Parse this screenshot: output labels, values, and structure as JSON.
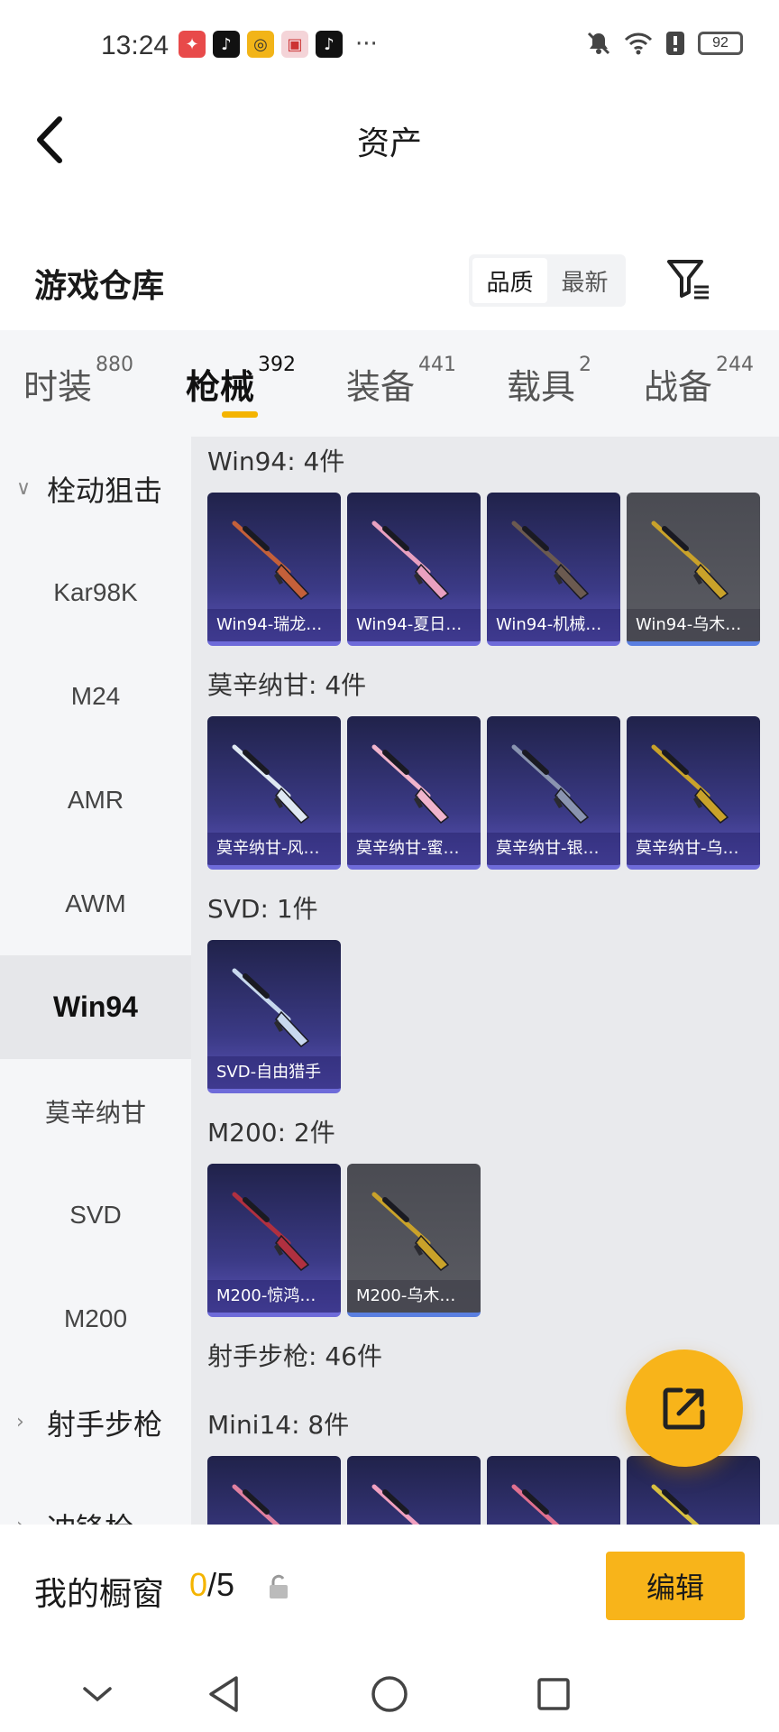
{
  "status_bar": {
    "time": "13:24",
    "notifications": [
      "huawei-app-icon",
      "tiktok-icon",
      "target-app-icon",
      "gift-app-icon",
      "tiktok-icon"
    ],
    "more": "···",
    "battery": "92"
  },
  "header": {
    "title": "资产"
  },
  "warehouse": {
    "title": "游戏仓库",
    "sort_options": [
      "品质",
      "最新"
    ],
    "active_sort": "品质"
  },
  "tabs": [
    {
      "label": "时装",
      "count": "880"
    },
    {
      "label": "枪械",
      "count": "392",
      "active": true
    },
    {
      "label": "装备",
      "count": "441"
    },
    {
      "label": "载具",
      "count": "2"
    },
    {
      "label": "战备",
      "count": "244"
    }
  ],
  "sidebar": {
    "groups": [
      {
        "label": "栓动狙击",
        "expanded": true
      },
      {
        "label": "射手步枪",
        "expanded": false
      },
      {
        "label": "冲锋枪",
        "expanded": false
      }
    ],
    "items": [
      "Kar98K",
      "M24",
      "AMR",
      "AWM",
      "Win94",
      "莫辛纳甘",
      "SVD",
      "M200"
    ],
    "active_item": "Win94"
  },
  "sections": [
    {
      "title": "Win94: 4件",
      "items": [
        {
          "label": "Win94-瑞龙…",
          "rarity": "purple",
          "gun_color": "#c4603a"
        },
        {
          "label": "Win94-夏日…",
          "rarity": "purple",
          "gun_color": "#e8a0c0"
        },
        {
          "label": "Win94-机械…",
          "rarity": "purple",
          "gun_color": "#6b5a50"
        },
        {
          "label": "Win94-乌木…",
          "rarity": "grey",
          "gun_color": "#c9a22a"
        }
      ]
    },
    {
      "title": "莫辛纳甘: 4件",
      "items": [
        {
          "label": "莫辛纳甘-风…",
          "rarity": "purple",
          "gun_color": "#dfe8f2"
        },
        {
          "label": "莫辛纳甘-蜜…",
          "rarity": "purple",
          "gun_color": "#f0b4cc"
        },
        {
          "label": "莫辛纳甘-银…",
          "rarity": "purple",
          "gun_color": "#8a94b0"
        },
        {
          "label": "莫辛纳甘-乌…",
          "rarity": "purple",
          "gun_color": "#c9a22a"
        }
      ]
    },
    {
      "title": "SVD: 1件",
      "items": [
        {
          "label": "SVD-自由猎手",
          "rarity": "purple",
          "gun_color": "#c8d8ee"
        }
      ]
    },
    {
      "title": "M200: 2件",
      "items": [
        {
          "label": "M200-惊鸿…",
          "rarity": "purple",
          "gun_color": "#b03040"
        },
        {
          "label": "M200-乌木…",
          "rarity": "grey",
          "gun_color": "#c9a22a"
        }
      ]
    },
    {
      "title": "射手步枪: 46件",
      "items": []
    },
    {
      "title": "Mini14: 8件",
      "items": [
        {
          "label": "",
          "rarity": "purple",
          "gun_color": "#e080a0"
        },
        {
          "label": "",
          "rarity": "purple",
          "gun_color": "#f0a0c0"
        },
        {
          "label": "",
          "rarity": "purple",
          "gun_color": "#e07090"
        },
        {
          "label": "",
          "rarity": "purple",
          "gun_color": "#d8c040"
        }
      ]
    }
  ],
  "showcase": {
    "title": "我的橱窗",
    "current": "0",
    "total": "/5",
    "edit_label": "编辑"
  },
  "colors": {
    "accent": "#f8b41a",
    "card_purple": "#3b3a86",
    "card_grey": "#55565d"
  }
}
